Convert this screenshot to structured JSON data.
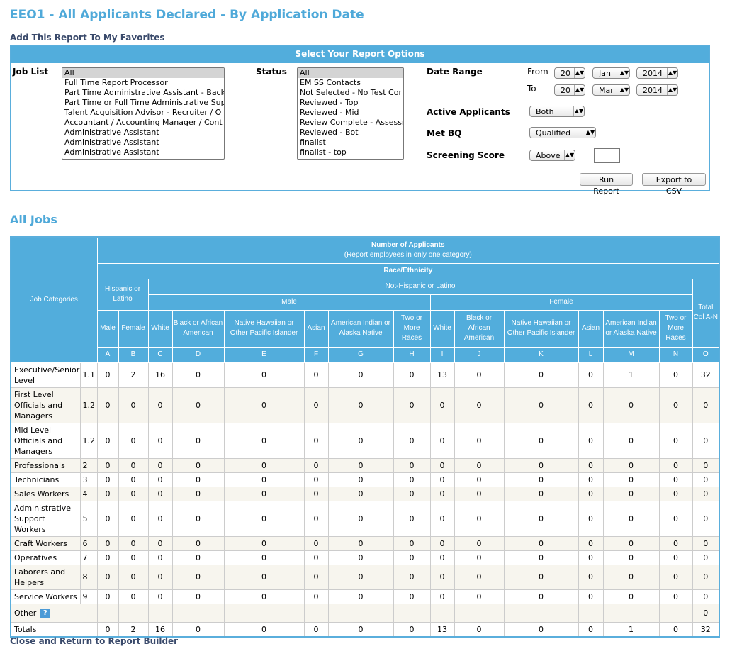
{
  "page": {
    "title": "EEO1 - All Applicants Declared - By Application Date",
    "favorites_link": "Add This Report To My Favorites",
    "close_link": "Close and Return to Report Builder",
    "section_title": "All Jobs"
  },
  "options": {
    "header": "Select Your Report Options",
    "job_list_label": "Job List",
    "job_list": [
      "All",
      "Full Time Report Processor",
      "Part Time Administrative Assistant - Backg",
      "Part Time or Full Time Administrative Sup",
      "Talent Acquisition Advisor - Recruiter / O",
      "Accountant / Accounting Manager / Cont",
      "Administrative Assistant",
      "Administrative Assistant",
      "Administrative Assistant"
    ],
    "status_label": "Status",
    "status_list": [
      "All",
      "EM SS Contacts",
      "Not Selected - No Test Cor",
      "Reviewed - Top",
      "Reviewed - Mid",
      "Review Complete - Assessr",
      "Reviewed - Bot",
      "finalist",
      "finalist - top"
    ],
    "date_range_label": "Date Range",
    "from_label": "From",
    "to_label": "To",
    "from": {
      "day": "20",
      "month": "Jan",
      "year": "2014"
    },
    "to": {
      "day": "20",
      "month": "Mar",
      "year": "2014"
    },
    "active_label": "Active Applicants",
    "active_value": "Both",
    "metbq_label": "Met BQ",
    "metbq_value": "Qualified",
    "screening_label": "Screening Score",
    "screening_value": "Above",
    "screening_input": "",
    "run_button": "Run Report",
    "export_button": "Export to CSV"
  },
  "table": {
    "job_categories": "Job Categories",
    "number_title": "Number of Applicants",
    "number_sub": "(Report employees in only one category)",
    "race": "Race/Ethnicity",
    "hispanic": "Hispanic or Latino",
    "not_hispanic": "Not-Hispanic or Latino",
    "male": "Male",
    "female": "Female",
    "total": "Total Col A-N",
    "columns": [
      "Male",
      "Female",
      "White",
      "Black or African American",
      "Native Hawaiian or Other Pacific Islander",
      "Asian",
      "American Indian or Alaska Native",
      "Two or More Races",
      "White",
      "Black or African American",
      "Native Hawaiian or Other Pacific Islander",
      "Asian",
      "American Indian or Alaska Native",
      "Two or More Races"
    ],
    "letters": [
      "A",
      "B",
      "C",
      "D",
      "E",
      "F",
      "G",
      "H",
      "I",
      "J",
      "K",
      "L",
      "M",
      "N",
      "O"
    ],
    "rows": [
      {
        "name": "Executive/Senior Level",
        "code": "1.1",
        "values": [
          "0",
          "2",
          "16",
          "0",
          "0",
          "0",
          "0",
          "0",
          "13",
          "0",
          "0",
          "0",
          "1",
          "0",
          "32"
        ]
      },
      {
        "name": "First Level Officials and Managers",
        "code": "1.2",
        "values": [
          "0",
          "0",
          "0",
          "0",
          "0",
          "0",
          "0",
          "0",
          "0",
          "0",
          "0",
          "0",
          "0",
          "0",
          "0"
        ]
      },
      {
        "name": "Mid Level Officials and Managers",
        "code": "1.2",
        "values": [
          "0",
          "0",
          "0",
          "0",
          "0",
          "0",
          "0",
          "0",
          "0",
          "0",
          "0",
          "0",
          "0",
          "0",
          "0"
        ]
      },
      {
        "name": "Professionals",
        "code": "2",
        "values": [
          "0",
          "0",
          "0",
          "0",
          "0",
          "0",
          "0",
          "0",
          "0",
          "0",
          "0",
          "0",
          "0",
          "0",
          "0"
        ]
      },
      {
        "name": "Technicians",
        "code": "3",
        "values": [
          "0",
          "0",
          "0",
          "0",
          "0",
          "0",
          "0",
          "0",
          "0",
          "0",
          "0",
          "0",
          "0",
          "0",
          "0"
        ]
      },
      {
        "name": "Sales Workers",
        "code": "4",
        "values": [
          "0",
          "0",
          "0",
          "0",
          "0",
          "0",
          "0",
          "0",
          "0",
          "0",
          "0",
          "0",
          "0",
          "0",
          "0"
        ]
      },
      {
        "name": "Administrative Support Workers",
        "code": "5",
        "values": [
          "0",
          "0",
          "0",
          "0",
          "0",
          "0",
          "0",
          "0",
          "0",
          "0",
          "0",
          "0",
          "0",
          "0",
          "0"
        ]
      },
      {
        "name": "Craft Workers",
        "code": "6",
        "values": [
          "0",
          "0",
          "0",
          "0",
          "0",
          "0",
          "0",
          "0",
          "0",
          "0",
          "0",
          "0",
          "0",
          "0",
          "0"
        ]
      },
      {
        "name": "Operatives",
        "code": "7",
        "values": [
          "0",
          "0",
          "0",
          "0",
          "0",
          "0",
          "0",
          "0",
          "0",
          "0",
          "0",
          "0",
          "0",
          "0",
          "0"
        ]
      },
      {
        "name": "Laborers and Helpers",
        "code": "8",
        "values": [
          "0",
          "0",
          "0",
          "0",
          "0",
          "0",
          "0",
          "0",
          "0",
          "0",
          "0",
          "0",
          "0",
          "0",
          "0"
        ]
      },
      {
        "name": "Service Workers",
        "code": "9",
        "values": [
          "0",
          "0",
          "0",
          "0",
          "0",
          "0",
          "0",
          "0",
          "0",
          "0",
          "0",
          "0",
          "0",
          "0",
          "0"
        ]
      }
    ],
    "other": {
      "name": "Other",
      "help_icon": "?",
      "values": [
        "",
        "",
        "",
        "",
        "",
        "",
        "",
        "",
        "",
        "",
        "",
        "",
        "",
        "",
        "0"
      ]
    },
    "totals": {
      "name": "Totals",
      "values": [
        "0",
        "2",
        "16",
        "0",
        "0",
        "0",
        "0",
        "0",
        "13",
        "0",
        "0",
        "0",
        "1",
        "0",
        "32"
      ]
    }
  },
  "colors": {
    "accent": "#52addc",
    "title": "#4fa9d9",
    "link": "#3a4a6b",
    "alt_row": "#f7f5ee"
  }
}
